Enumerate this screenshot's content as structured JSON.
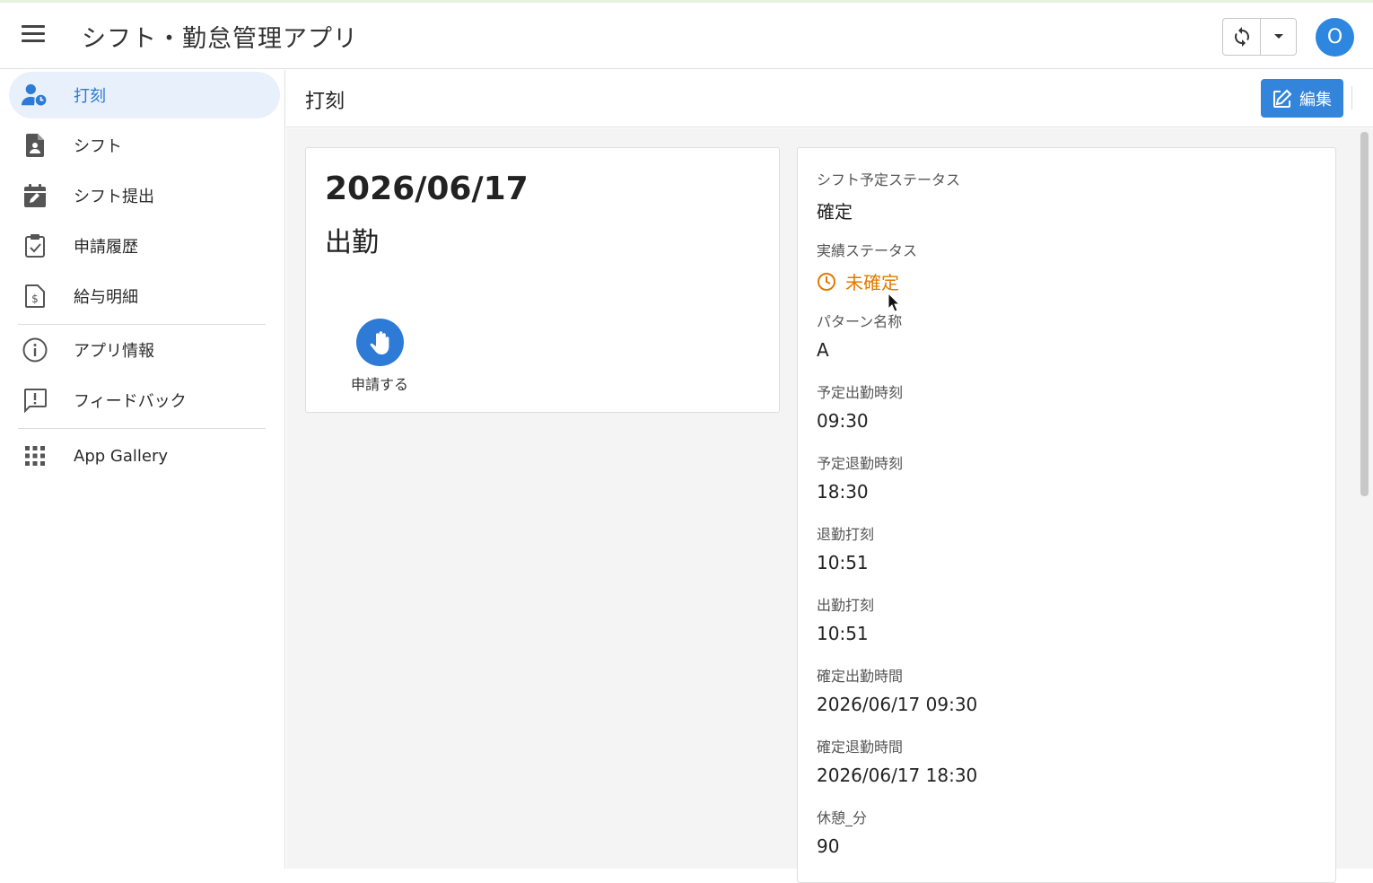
{
  "header": {
    "app_title": "シフト・勤怠管理アプリ",
    "avatar_initial": "O"
  },
  "sidebar": {
    "items": [
      {
        "label": "打刻",
        "icon": "user-clock-icon",
        "active": true
      },
      {
        "label": "シフト",
        "icon": "document-person-icon"
      },
      {
        "label": "シフト提出",
        "icon": "calendar-edit-icon"
      },
      {
        "label": "申請履歴",
        "icon": "clipboard-check-icon"
      },
      {
        "label": "給与明細",
        "icon": "receipt-dollar-icon"
      },
      {
        "label": "アプリ情報",
        "icon": "info-icon"
      },
      {
        "label": "フィードバック",
        "icon": "feedback-icon"
      },
      {
        "label": "App Gallery",
        "icon": "grid-icon"
      }
    ]
  },
  "content": {
    "page_title": "打刻",
    "edit_label": "編集",
    "card": {
      "date": "2026/06/17",
      "status": "出勤",
      "apply_label": "申請する"
    },
    "details": [
      {
        "label": "シフト予定ステータス",
        "value": "確定"
      },
      {
        "label": "実績ステータス",
        "value": "未確定",
        "warn": true
      },
      {
        "label": "パターン名称",
        "value": "A"
      },
      {
        "label": "予定出勤時刻",
        "value": "09:30"
      },
      {
        "label": "予定退勤時刻",
        "value": "18:30"
      },
      {
        "label": "退勤打刻",
        "value": "10:51"
      },
      {
        "label": "出勤打刻",
        "value": "10:51"
      },
      {
        "label": "確定出勤時間",
        "value": "2026/06/17 09:30"
      },
      {
        "label": "確定退勤時間",
        "value": "2026/06/17 18:30"
      },
      {
        "label": "休憩_分",
        "value": "90"
      }
    ]
  },
  "colors": {
    "accent": "#2d7bd6",
    "warning": "#e07b00",
    "avatar": "#2d87e0"
  }
}
